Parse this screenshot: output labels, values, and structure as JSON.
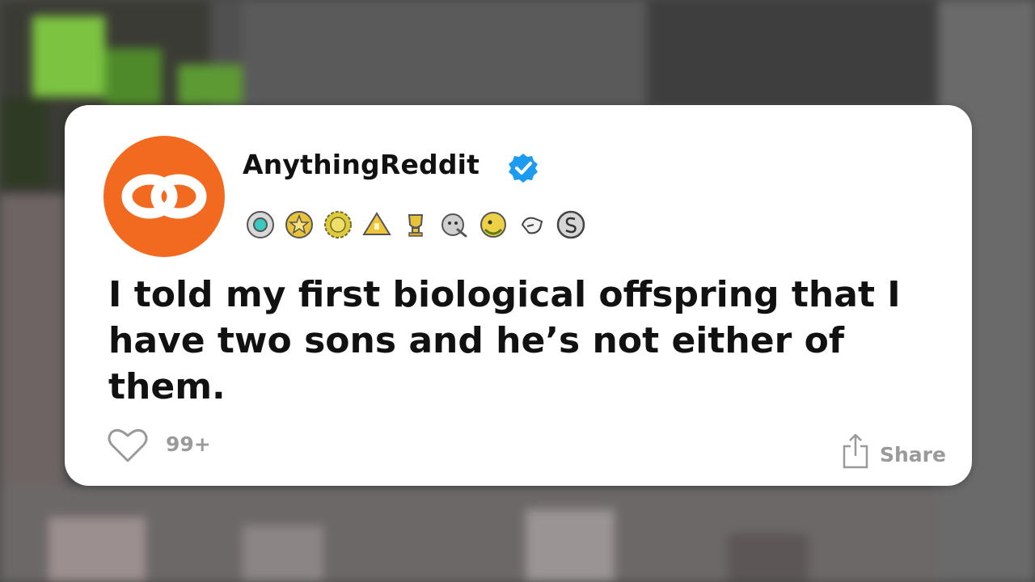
{
  "post": {
    "username": "AnythingReddit",
    "text": "I told my first biological offspring that I have two sons and he’s not either of them.",
    "like_count": "99+",
    "share_label": "Share"
  },
  "icons": {
    "avatar": "orange-circle-infinity-logo",
    "verified": "blue-checkmark-badge",
    "like": "heart-outline-icon",
    "share": "share-arrow-icon"
  },
  "colors": {
    "avatar": "#f26a1f",
    "verified": "#1d9bf0",
    "text": "#111111",
    "muted": "#9a9a9a",
    "card": "#ffffff"
  }
}
